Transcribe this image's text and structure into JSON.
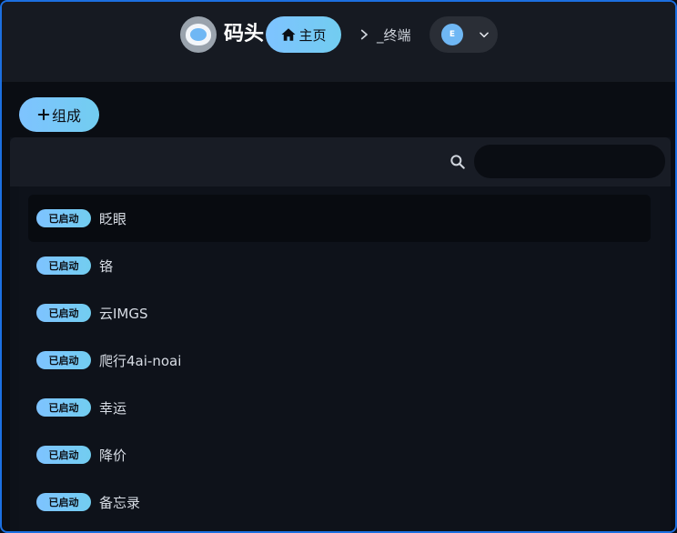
{
  "header": {
    "brand": "码头",
    "nav": {
      "home_label": "主页",
      "terminal_label": "_终端"
    },
    "user": {
      "avatar_initial": "E"
    }
  },
  "actions": {
    "compose_label": "组成"
  },
  "search": {
    "value": "",
    "placeholder": ""
  },
  "items": [
    {
      "status": "已启动",
      "name": "眨眼"
    },
    {
      "status": "已启动",
      "name": "铬"
    },
    {
      "status": "已启动",
      "name": "云IMGS"
    },
    {
      "status": "已启动",
      "name": "爬行4ai-noai"
    },
    {
      "status": "已启动",
      "name": "幸运"
    },
    {
      "status": "已启动",
      "name": "降价"
    },
    {
      "status": "已启动",
      "name": "备忘录"
    }
  ],
  "colors": {
    "accent": "#7ec3ff",
    "frame_border": "#1c6fe0",
    "background": "#0a0d13",
    "topbar": "#161a22"
  },
  "icons": [
    "logo-icon",
    "home-icon",
    "terminal-icon",
    "chevron-down-icon",
    "plus-icon",
    "search-icon"
  ]
}
